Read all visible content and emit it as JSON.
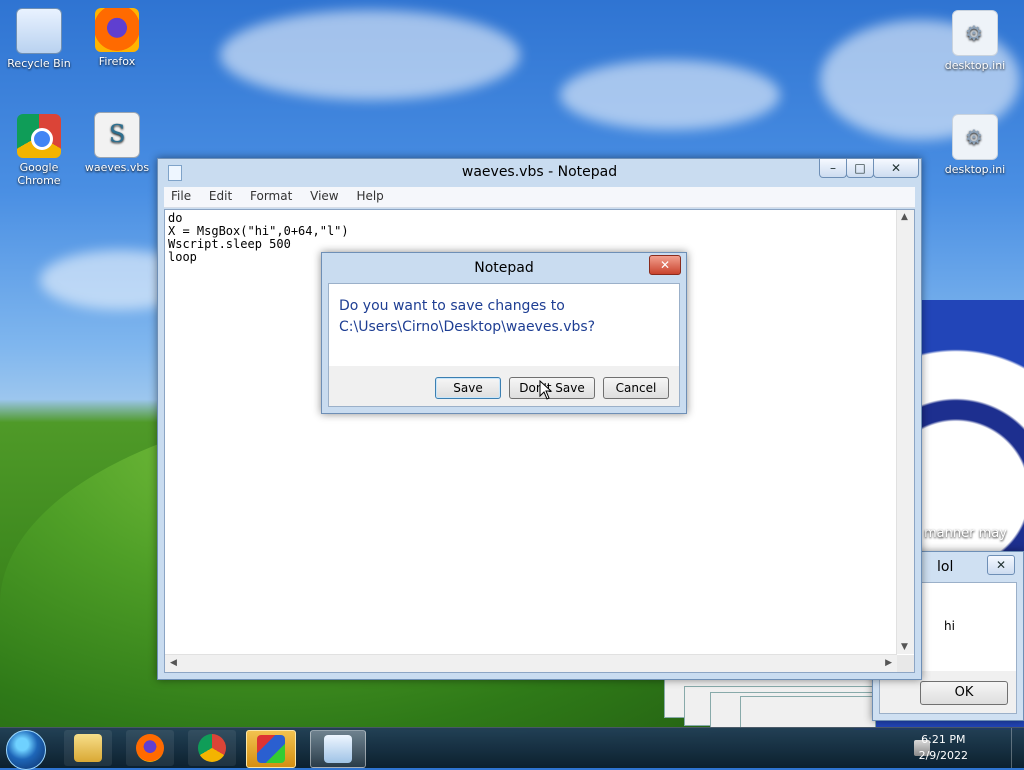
{
  "desktop": {
    "icons": [
      {
        "label": "Recycle Bin"
      },
      {
        "label": "Firefox"
      },
      {
        "label": "Google Chrome"
      },
      {
        "label": "waeves.vbs"
      },
      {
        "label": "desktop.ini"
      },
      {
        "label": "desktop.ini"
      }
    ],
    "overlay_text": "manner may"
  },
  "notepad": {
    "title": "waeves.vbs - Notepad",
    "menu": [
      "File",
      "Edit",
      "Format",
      "View",
      "Help"
    ],
    "content": "do\nX = MsgBox(\"hi\",0+64,\"l\")\nWscript.sleep 500\nloop",
    "caption_buttons": {
      "minimize": "–",
      "maximize": "□",
      "close": "✕"
    }
  },
  "save_dialog": {
    "title": "Notepad",
    "message_line1": "Do you want to save changes to",
    "message_line2": "C:\\Users\\Cirno\\Desktop\\waeves.vbs?",
    "buttons": {
      "save": "Save",
      "dont_save": "Don't Save",
      "cancel": "Cancel"
    }
  },
  "msgbox": {
    "title": "lol",
    "message": "hi",
    "ok": "OK"
  },
  "taskbar": {
    "clock_time": "6:21 PM",
    "clock_date": "2/9/2022"
  }
}
